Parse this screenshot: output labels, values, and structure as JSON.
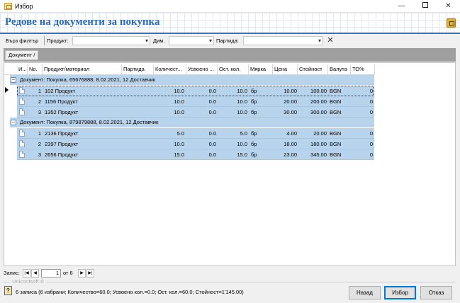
{
  "window": {
    "title": "Избор"
  },
  "header": {
    "title": "Редове на документи за покупка"
  },
  "filter": {
    "quick_filter_label": "Бърз филтър",
    "product_label": "Продукт:",
    "dim_label": "Дим.",
    "batch_label": "Партида:",
    "product_value": "",
    "dim_value": "",
    "batch_value": ""
  },
  "group_panel": {
    "chip_label": "Документ",
    "chip_sort": "/"
  },
  "columns": [
    "И...",
    "No.",
    "Продукт/материал",
    "Партида",
    "Количест...",
    "Усвоено ...",
    "Ост. кол.",
    "Мярка",
    "Цена",
    "Стойност",
    "Валута",
    "ТО%"
  ],
  "groups": [
    {
      "label": "Документ: Покупка, 65676888, 8.02.2021, 12 Доставчик",
      "rows": [
        {
          "no": "1",
          "product": "102 Продукт",
          "batch": "",
          "qty": "10.0",
          "absorbed": "0.0",
          "remaining": "10.0",
          "unit": "бр",
          "price": "10.00",
          "value": "100.00",
          "currency": "BGN",
          "to": "0"
        },
        {
          "no": "2",
          "product": "1156 Продукт",
          "batch": "",
          "qty": "10.0",
          "absorbed": "0.0",
          "remaining": "10.0",
          "unit": "бр",
          "price": "20.00",
          "value": "200.00",
          "currency": "BGN",
          "to": "0"
        },
        {
          "no": "3",
          "product": "1352 Продукт",
          "batch": "",
          "qty": "10.0",
          "absorbed": "0.0",
          "remaining": "10.0",
          "unit": "бр",
          "price": "30.00",
          "value": "300.00",
          "currency": "BGN",
          "to": "0"
        }
      ]
    },
    {
      "label": "Документ: Покупка, 879879888, 8.02.2021, 12 Доставчик",
      "rows": [
        {
          "no": "1",
          "product": "2136 Продукт",
          "batch": "",
          "qty": "5.0",
          "absorbed": "0.0",
          "remaining": "5.0",
          "unit": "бр",
          "price": "4.00",
          "value": "20.00",
          "currency": "BGN",
          "to": "0"
        },
        {
          "no": "2",
          "product": "2397 Продукт",
          "batch": "",
          "qty": "10.0",
          "absorbed": "0.0",
          "remaining": "10.0",
          "unit": "бр",
          "price": "18.00",
          "value": "180.00",
          "currency": "BGN",
          "to": "0"
        },
        {
          "no": "3",
          "product": "2656 Продукт",
          "batch": "",
          "qty": "15.0",
          "absorbed": "0.0",
          "remaining": "15.0",
          "unit": "бр",
          "price": "23.00",
          "value": "345.00",
          "currency": "BGN",
          "to": "0"
        }
      ]
    }
  ],
  "navigator": {
    "label": "Запис:",
    "current": "1",
    "of_text": "от 6"
  },
  "brand": "Unicontsoft ®",
  "status": {
    "text": "6 записа (6 избрани; Количество=60.0; Усвоено кол.=0.0; Ост. кол.=60.0; Стойност=1'145.00)"
  },
  "buttons": {
    "back": "Назад",
    "select": "Избор",
    "cancel": "Отказ"
  },
  "colors": {
    "accent": "#2a67b6",
    "selection": "#b8d3ec",
    "group_panel": "#9f9f9f"
  }
}
